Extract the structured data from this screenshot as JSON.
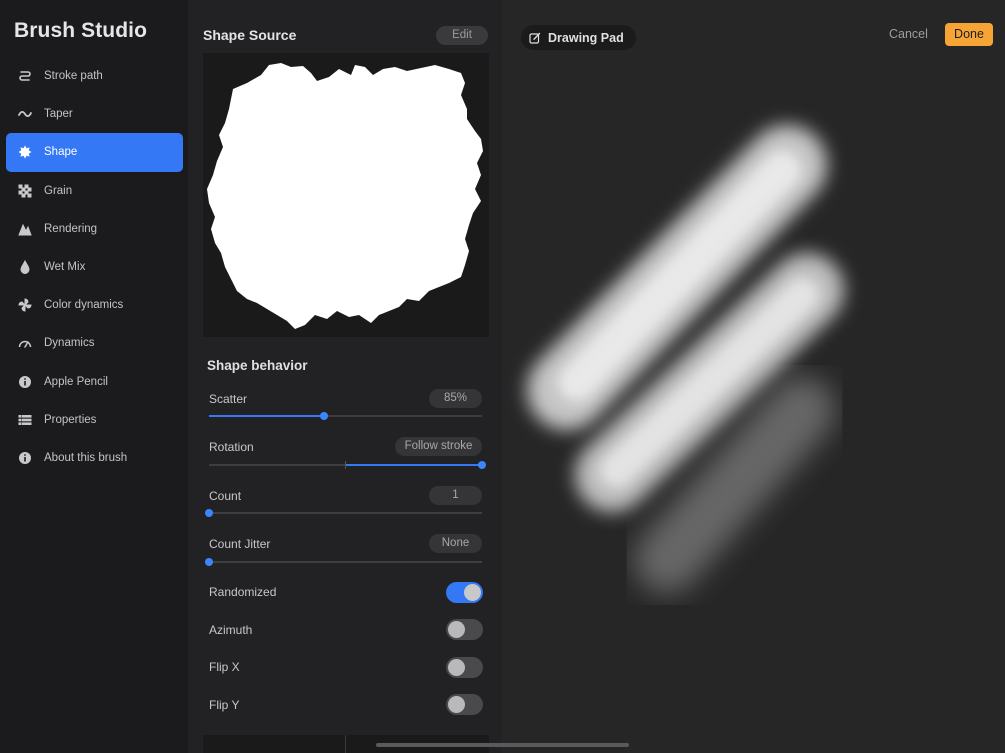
{
  "app": {
    "title": "Brush Studio"
  },
  "sidebar": {
    "items": [
      {
        "label": "Stroke path",
        "icon": "stroke-path-icon",
        "active": false
      },
      {
        "label": "Taper",
        "icon": "taper-icon",
        "active": false
      },
      {
        "label": "Shape",
        "icon": "shape-icon",
        "active": true
      },
      {
        "label": "Grain",
        "icon": "grain-icon",
        "active": false
      },
      {
        "label": "Rendering",
        "icon": "rendering-icon",
        "active": false
      },
      {
        "label": "Wet Mix",
        "icon": "wet-mix-icon",
        "active": false
      },
      {
        "label": "Color dynamics",
        "icon": "color-dynamics-icon",
        "active": false
      },
      {
        "label": "Dynamics",
        "icon": "dynamics-icon",
        "active": false
      },
      {
        "label": "Apple Pencil",
        "icon": "info-icon",
        "active": false
      },
      {
        "label": "Properties",
        "icon": "list-icon",
        "active": false
      },
      {
        "label": "About this brush",
        "icon": "info-icon",
        "active": false
      }
    ]
  },
  "shape_source": {
    "title": "Shape Source",
    "edit_label": "Edit"
  },
  "shape_behavior": {
    "title": "Shape behavior",
    "scatter": {
      "label": "Scatter",
      "value": "85%",
      "fraction": 0.42
    },
    "rotation": {
      "label": "Rotation",
      "value": "Follow stroke",
      "fraction": 1.0
    },
    "count": {
      "label": "Count",
      "value": "1",
      "fraction": 0.0
    },
    "count_jitter": {
      "label": "Count Jitter",
      "value": "None",
      "fraction": 0.0
    },
    "randomized": {
      "label": "Randomized",
      "on": true
    },
    "azimuth": {
      "label": "Azimuth",
      "on": false
    },
    "flip_x": {
      "label": "Flip X",
      "on": false
    },
    "flip_y": {
      "label": "Flip Y",
      "on": false
    }
  },
  "drawing_pad": {
    "title": "Drawing Pad",
    "icon": "edit-square-icon",
    "cancel_label": "Cancel",
    "done_label": "Done"
  },
  "colors": {
    "accent": "#3478f6",
    "done": "#f7a437"
  }
}
